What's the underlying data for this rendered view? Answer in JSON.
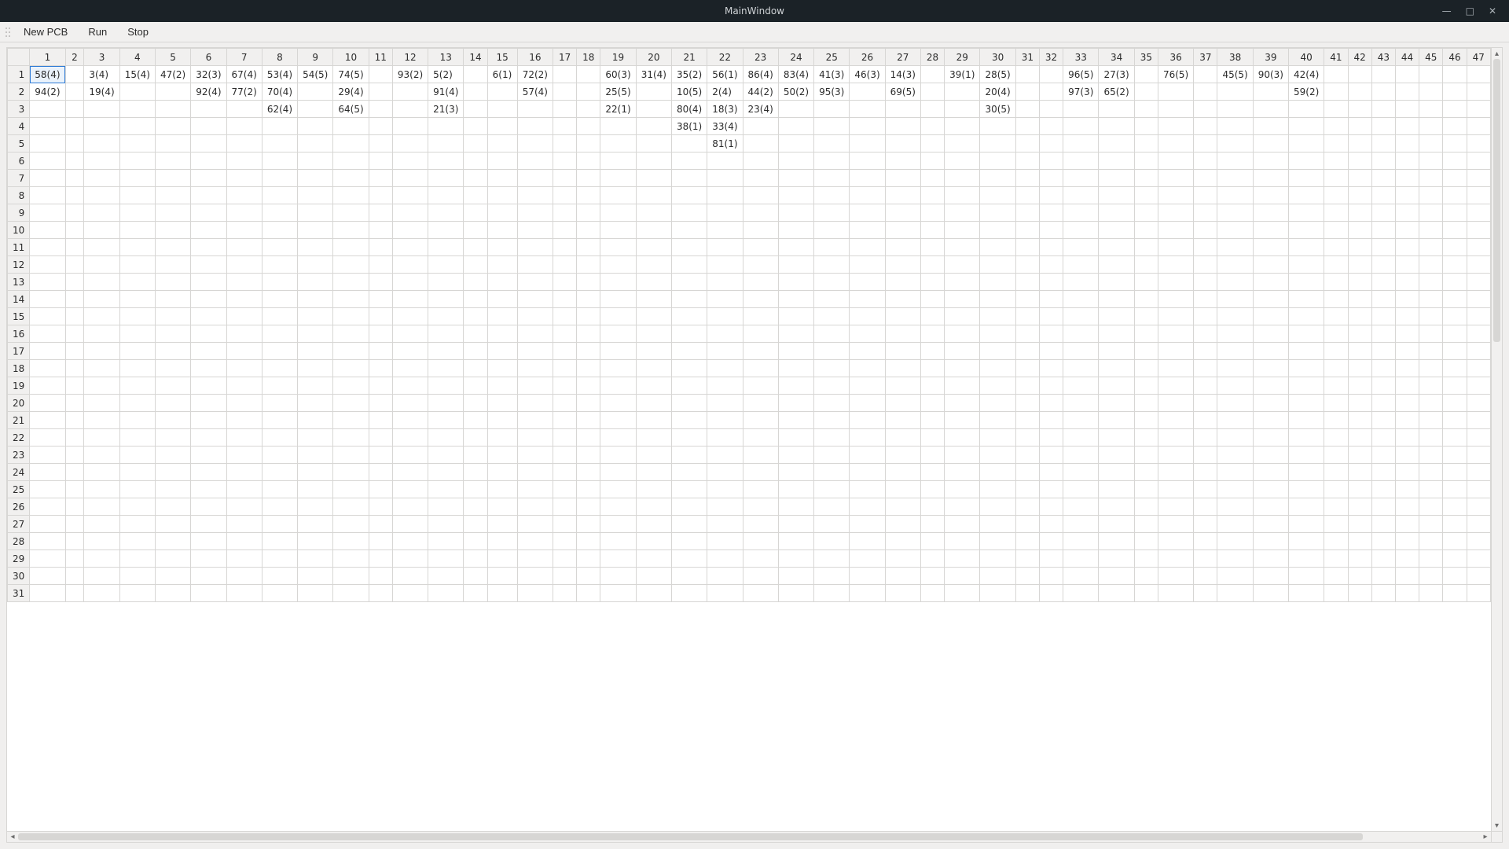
{
  "window": {
    "title": "MainWindow"
  },
  "toolbar": {
    "new_pcb": "New PCB",
    "run": "Run",
    "stop": "Stop"
  },
  "grid": {
    "visible_cols": 47,
    "visible_rows": 31,
    "selected": {
      "row": 1,
      "col": 1
    },
    "cells": {
      "1": {
        "1": "58(4)",
        "3": "3(4)",
        "4": "15(4)",
        "5": "47(2)",
        "6": "32(3)",
        "7": "67(4)",
        "8": "53(4)",
        "9": "54(5)",
        "10": "74(5)",
        "12": "93(2)",
        "13": "5(2)",
        "15": "6(1)",
        "16": "72(2)",
        "19": "60(3)",
        "20": "31(4)",
        "21": "35(2)",
        "22": "56(1)",
        "23": "86(4)",
        "24": "83(4)",
        "25": "41(3)",
        "26": "46(3)",
        "27": "14(3)",
        "29": "39(1)",
        "30": "28(5)",
        "33": "96(5)",
        "34": "27(3)",
        "36": "76(5)",
        "38": "45(5)",
        "39": "90(3)",
        "40": "42(4)"
      },
      "2": {
        "1": "94(2)",
        "3": "19(4)",
        "6": "92(4)",
        "7": "77(2)",
        "8": "70(4)",
        "10": "29(4)",
        "13": "91(4)",
        "16": "57(4)",
        "19": "25(5)",
        "21": "10(5)",
        "22": "2(4)",
        "23": "44(2)",
        "24": "50(2)",
        "25": "95(3)",
        "27": "69(5)",
        "30": "20(4)",
        "33": "97(3)",
        "34": "65(2)",
        "40": "59(2)"
      },
      "3": {
        "8": "62(4)",
        "10": "64(5)",
        "13": "21(3)",
        "19": "22(1)",
        "21": "80(4)",
        "22": "18(3)",
        "23": "23(4)",
        "30": "30(5)"
      },
      "4": {
        "21": "38(1)",
        "22": "33(4)"
      },
      "5": {
        "22": "81(1)"
      }
    }
  }
}
